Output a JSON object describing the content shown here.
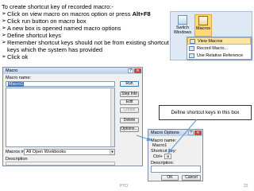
{
  "slide": {
    "title": "To create shortcut key of recorded macro:-",
    "bullets": [
      {
        "text": "Click on view macro on macros option or press ",
        "bold": "Alt+F8"
      },
      {
        "text": "Click run button on macro box",
        "bold": ""
      },
      {
        "text": "A new box is opened named macro options",
        "bold": ""
      },
      {
        "text": "Define shortcut keys",
        "bold": ""
      },
      {
        "text": "Remember shortcut keys should not be from existing shortcut keys which the system has provided",
        "bold": ""
      },
      {
        "text": "Click ok",
        "bold": ""
      }
    ],
    "bullet_icon": "checkmark-arrow-bullet",
    "footer_center": "PTO",
    "page_number": "22"
  },
  "ribbon": {
    "switch_label_1": "Switch",
    "switch_label_2": "Windows",
    "macros_label": "Macros",
    "menu_items": [
      "View Macros",
      "Record Macro...",
      "Use Relative Reference"
    ]
  },
  "macro_dialog": {
    "title": "Macro",
    "name_label": "Macro name:",
    "name_value": "Macro1",
    "buttons": [
      "Run",
      "Step Into",
      "Edit",
      "Create",
      "Delete",
      "Options..."
    ],
    "macros_in_label": "Macros in:",
    "macros_in_value": "All Open Workbooks",
    "description_label": "Description"
  },
  "callout": {
    "text": "Define shortcut keys in this box"
  },
  "options_dialog": {
    "title": "Macro Options",
    "name_label": "Macro name:",
    "name_value": "Macro1",
    "shortcut_label": "Shortcut key:",
    "ctrl_label": "Ctrl+",
    "ctrl_value": "a",
    "description_label": "Description:",
    "ok_label": "OK",
    "cancel_label": "Cancel"
  },
  "colors": {
    "accent_arrow": "#5b9bd5",
    "titlebar": "#c5d7ee",
    "highlight": "#fde6a2"
  }
}
